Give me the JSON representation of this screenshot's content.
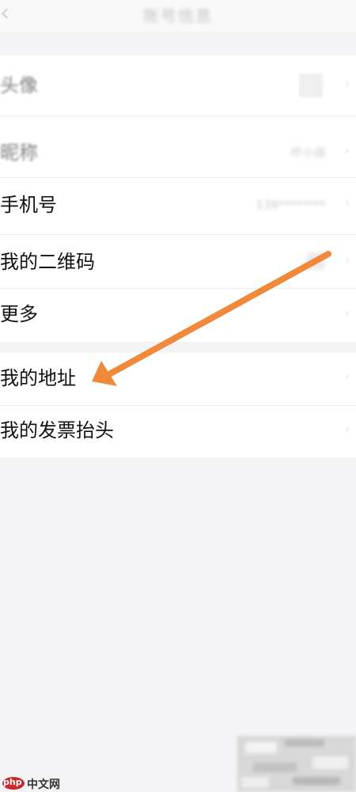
{
  "header": {
    "title": "账号信息",
    "back_glyph": "‹"
  },
  "profile": {
    "items": [
      {
        "label": "头像",
        "value": "",
        "blurred": true
      },
      {
        "label": "昵称",
        "value": "坏小孩",
        "blurred": true
      },
      {
        "label": "手机号",
        "value": "138********"
      },
      {
        "label": "我的二维码",
        "value": ""
      },
      {
        "label": "更多",
        "value": ""
      }
    ]
  },
  "address": {
    "items": [
      {
        "label": "我的地址"
      },
      {
        "label": "我的发票抬头"
      }
    ]
  },
  "watermark": {
    "logo_text": "php",
    "site_text": "中文网"
  },
  "colors": {
    "arrow": "#f0893c",
    "background": "#f4f4f6",
    "card": "#ffffff"
  },
  "icons": {
    "back": "chevron-left-icon",
    "row_arrow": "chevron-right-icon"
  }
}
